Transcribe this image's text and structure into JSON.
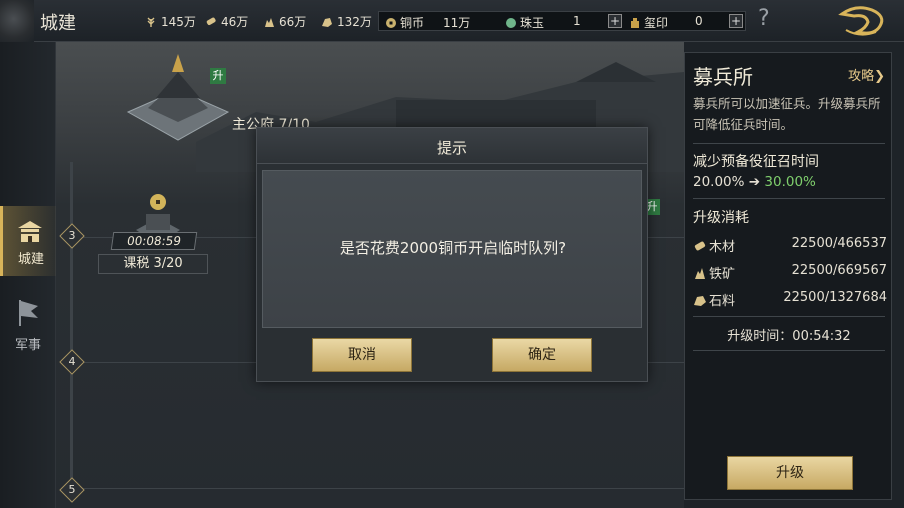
{
  "header": {
    "title": "城建",
    "resources": [
      {
        "icon": "wheat-icon",
        "value": "145万"
      },
      {
        "icon": "wood-icon",
        "value": "46万"
      },
      {
        "icon": "ore-icon",
        "value": "66万"
      },
      {
        "icon": "stone-icon",
        "value": "132万"
      }
    ],
    "currencies": [
      {
        "icon": "copper-coin-icon",
        "label": "铜币",
        "value": "11万"
      },
      {
        "icon": "jade-icon",
        "label": "珠玉",
        "value": "1"
      },
      {
        "icon": "seal-icon",
        "label": "玺印",
        "value": "0"
      }
    ],
    "help_symbol": "?"
  },
  "sidebar": {
    "items": [
      {
        "label": "城建",
        "icon": "city-icon",
        "active": true
      },
      {
        "label": "军事",
        "icon": "flag-icon",
        "active": false
      }
    ]
  },
  "scene": {
    "main_building": {
      "name": "主公府 7/10",
      "upgrade_badge": "升"
    },
    "tax": {
      "timer": "00:08:59",
      "label": "课税 3/20"
    },
    "side_badge": "升",
    "levels": [
      "3",
      "4",
      "5"
    ]
  },
  "panel": {
    "title": "募兵所",
    "guide_label": "攻略",
    "guide_arrow": "❯",
    "description": "募兵所可以加速征兵。升级募兵所可降低征兵时间。",
    "effect_title": "减少预备役征召时间",
    "effect_from": "20.00%",
    "effect_arrow": "➔",
    "effect_to": "30.00%",
    "cost_title": "升级消耗",
    "costs": [
      {
        "icon": "wood-icon",
        "name": "木材",
        "value": "22500/466537"
      },
      {
        "icon": "ore-icon",
        "name": "铁矿",
        "value": "22500/669567"
      },
      {
        "icon": "stone-icon",
        "name": "石料",
        "value": "22500/1327684"
      }
    ],
    "upgrade_time": "升级时间：00:54:32",
    "upgrade_button": "升级"
  },
  "dialog": {
    "title": "提示",
    "message": "是否花费2000铜币开启临时队列?",
    "cancel_label": "取消",
    "confirm_label": "确定"
  },
  "colors": {
    "accent_gold": "#d8b45a",
    "button_gold": "#c6a964",
    "effect_green": "#7fcf6d"
  }
}
